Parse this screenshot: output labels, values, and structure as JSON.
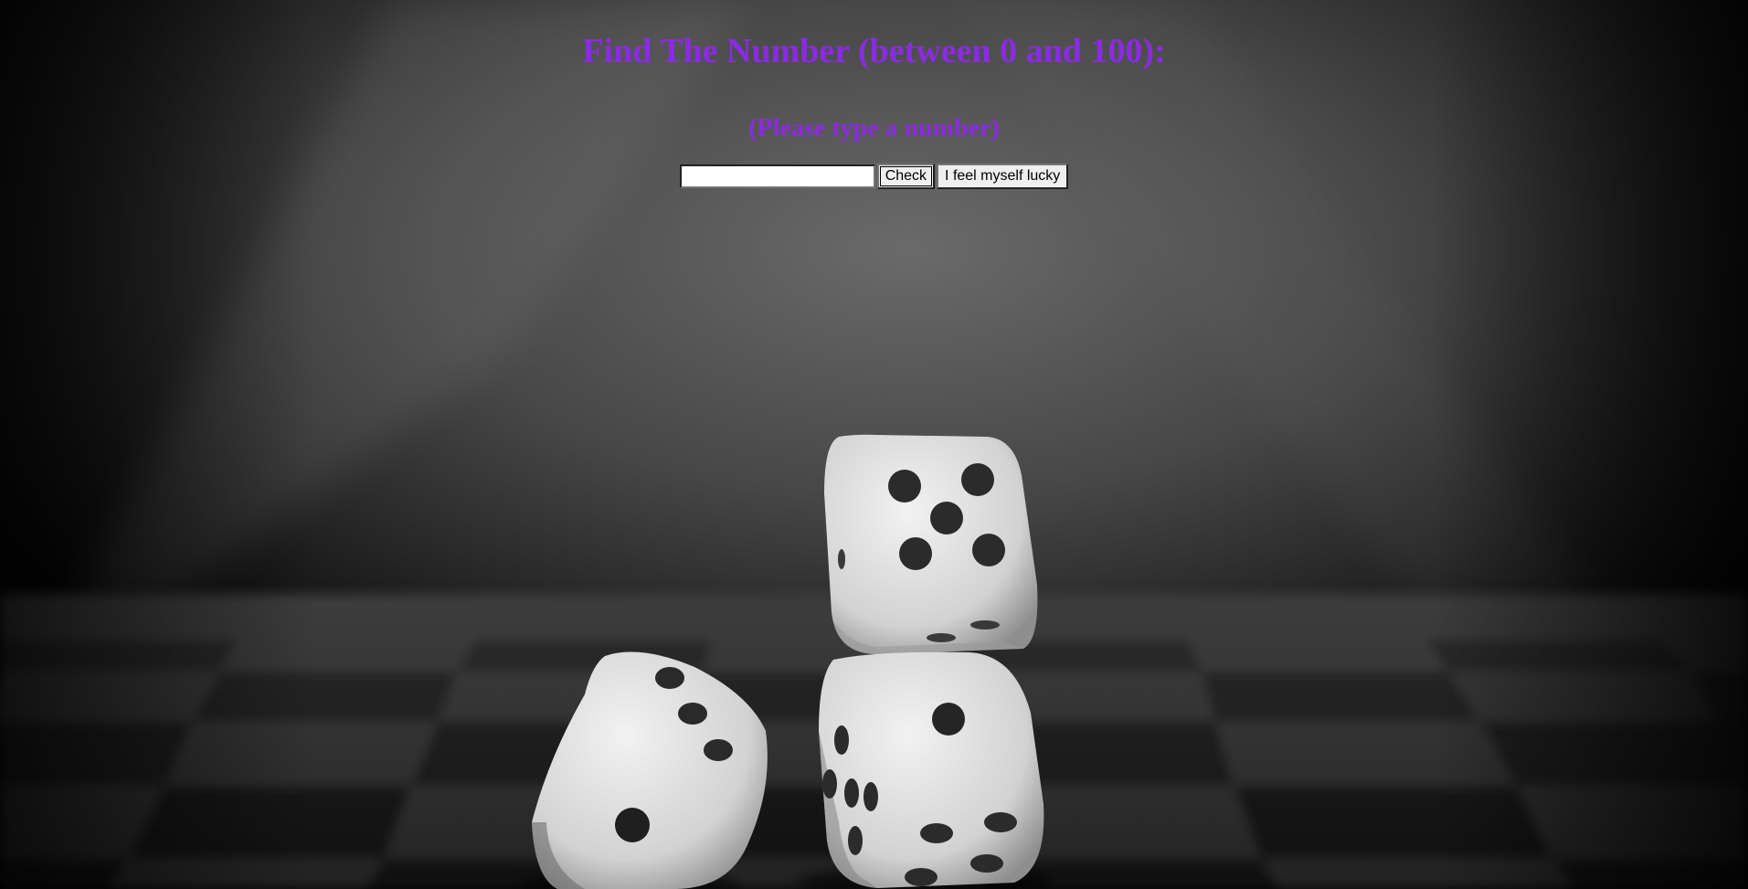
{
  "page": {
    "title": "Find The Number (between 0 and 100):",
    "subtitle": "(Please type a number)"
  },
  "form": {
    "input_value": "",
    "input_placeholder": "",
    "check_label": "Check",
    "lucky_label": "I feel myself lucky"
  },
  "colors": {
    "heading": "#8a2be2",
    "background": "#0b0b0b"
  },
  "background_image": {
    "subject": "black-and-white photo of three dice on a checkerboard",
    "dice": [
      {
        "name": "top-die",
        "top_face_pips": 5
      },
      {
        "name": "left-die",
        "front_face_pips": 1,
        "top_face_pips": 3
      },
      {
        "name": "right-die",
        "top_face_pips": 1,
        "front_face_pips": 5
      }
    ]
  }
}
